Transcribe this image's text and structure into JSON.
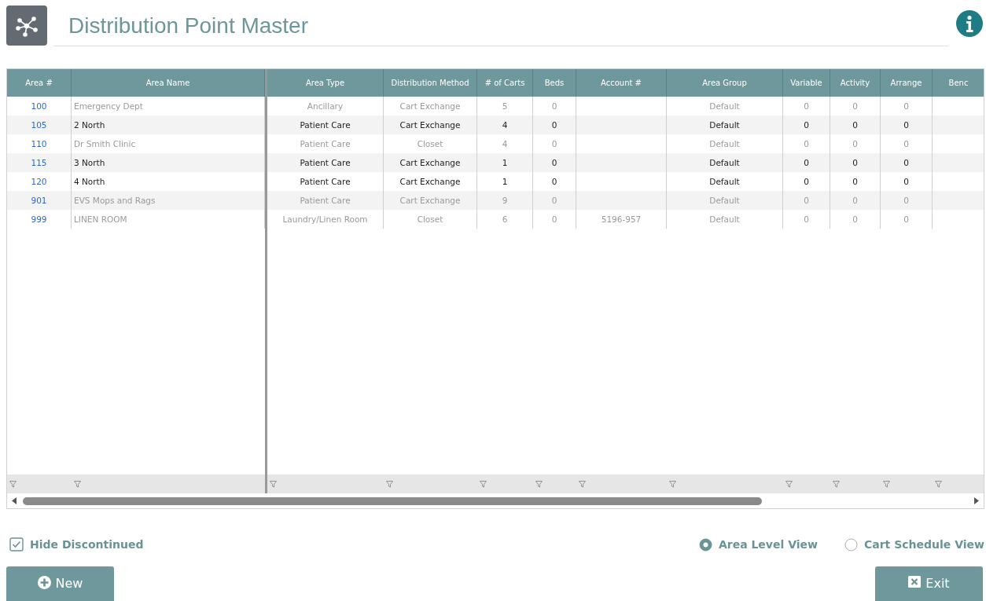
{
  "title": "Distribution Point Master",
  "table": {
    "columns": [
      {
        "label": "Area #"
      },
      {
        "label": "Area Name"
      },
      {
        "label": "Area Type"
      },
      {
        "label": "Distribution Method"
      },
      {
        "label": "# of Carts"
      },
      {
        "label": "Beds"
      },
      {
        "label": "Account #"
      },
      {
        "label": "Area Group"
      },
      {
        "label": "Variable"
      },
      {
        "label": "Activity"
      },
      {
        "label": "Arrange"
      },
      {
        "label": "Benc"
      }
    ],
    "rows": [
      {
        "cells": [
          "100",
          "Emergency Dept",
          "Ancillary",
          "Cart Exchange",
          "5",
          "0",
          null,
          "Default",
          "0",
          "0",
          "0",
          null
        ],
        "active": false
      },
      {
        "cells": [
          "105",
          "2 North",
          "Patient Care",
          "Cart Exchange",
          "4",
          "0",
          null,
          "Default",
          "0",
          "0",
          "0",
          null
        ],
        "active": true
      },
      {
        "cells": [
          "110",
          "Dr Smith Clinic",
          "Patient Care",
          "Closet",
          "4",
          "0",
          null,
          "Default",
          "0",
          "0",
          "0",
          null
        ],
        "active": false
      },
      {
        "cells": [
          "115",
          "3 North",
          "Patient Care",
          "Cart Exchange",
          "1",
          "0",
          null,
          "Default",
          "0",
          "0",
          "0",
          null
        ],
        "active": true
      },
      {
        "cells": [
          "120",
          "4 North",
          "Patient Care",
          "Cart Exchange",
          "1",
          "0",
          null,
          "Default",
          "0",
          "0",
          "0",
          null
        ],
        "active": true
      },
      {
        "cells": [
          "901",
          "EVS Mops and Rags",
          "Patient Care",
          "Cart Exchange",
          "9",
          "0",
          null,
          "Default",
          "0",
          "0",
          "0",
          null
        ],
        "active": false
      },
      {
        "cells": [
          "999",
          "LINEN ROOM",
          "Laundry/Linen Room",
          "Closet",
          "6",
          "0",
          "5196-957",
          "Default",
          "0",
          "0",
          "0",
          null
        ],
        "active": false
      }
    ]
  },
  "hide_discontinued": {
    "label": "Hide Discontinued",
    "checked": true
  },
  "views": [
    {
      "label": "Area Level View",
      "selected": true
    },
    {
      "label": "Cart Schedule View",
      "selected": false
    }
  ],
  "buttons": [
    {
      "kind": "new",
      "label": "New"
    },
    {
      "kind": "exit",
      "label": "Exit"
    }
  ]
}
